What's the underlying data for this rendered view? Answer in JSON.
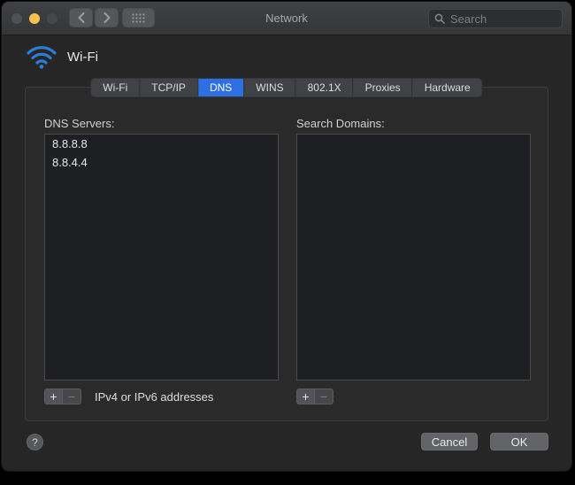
{
  "window": {
    "title": "Network"
  },
  "titlebar": {
    "traffic_lights": [
      {
        "name": "close-button",
        "color": "#4e5054"
      },
      {
        "name": "minimize-button",
        "color": "#f6c351"
      },
      {
        "name": "zoom-button",
        "color": "#46484c"
      }
    ],
    "search": {
      "placeholder": "Search",
      "value": ""
    }
  },
  "connection": {
    "name": "Wi-Fi"
  },
  "tabs": {
    "items": [
      {
        "label": "Wi-Fi",
        "selected": false
      },
      {
        "label": "TCP/IP",
        "selected": false
      },
      {
        "label": "DNS",
        "selected": true
      },
      {
        "label": "WINS",
        "selected": false
      },
      {
        "label": "802.1X",
        "selected": false
      },
      {
        "label": "Proxies",
        "selected": false
      },
      {
        "label": "Hardware",
        "selected": false
      }
    ]
  },
  "dns_panel": {
    "label": "DNS Servers:",
    "servers": [
      "8.8.8.8",
      "8.8.4.4"
    ],
    "add_label": "+",
    "remove_label": "−",
    "caption": "IPv4 or IPv6 addresses"
  },
  "search_domains_panel": {
    "label": "Search Domains:",
    "domains": [],
    "add_label": "+",
    "remove_label": "−"
  },
  "footer": {
    "help_label": "?",
    "cancel_label": "Cancel",
    "ok_label": "OK"
  },
  "colors": {
    "accent_selected_tab": "#2f6fe4",
    "wifi_icon": "#2a7fd4",
    "minimize_light": "#f6c351"
  }
}
